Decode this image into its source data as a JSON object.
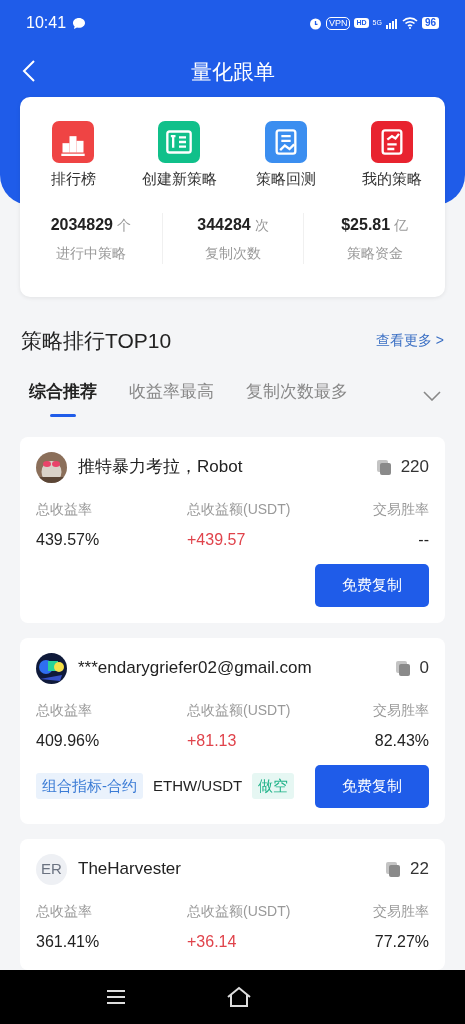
{
  "status_bar": {
    "time": "10:41",
    "vpn": "VPN",
    "hd": "HD",
    "network": "5G",
    "battery": "96"
  },
  "header": {
    "title": "量化跟单"
  },
  "shortcuts": [
    {
      "label": "排行榜",
      "color": "#ef4444"
    },
    {
      "label": "创建新策略",
      "color": "#10c08a"
    },
    {
      "label": "策略回测",
      "color": "#3b8ef0"
    },
    {
      "label": "我的策略",
      "color": "#e8232f"
    }
  ],
  "stats": [
    {
      "value": "2034829",
      "unit": "个",
      "label": "进行中策略"
    },
    {
      "value": "344284",
      "unit": "次",
      "label": "复制次数"
    },
    {
      "value": "$25.81",
      "unit": "亿",
      "label": "策略资金"
    }
  ],
  "section": {
    "title": "策略排行TOP10",
    "more": "查看更多 >"
  },
  "tabs": [
    {
      "label": "综合推荐",
      "selected": true
    },
    {
      "label": "收益率最高",
      "selected": false
    },
    {
      "label": "复制次数最多",
      "selected": false
    }
  ],
  "strategies": [
    {
      "avatar": {
        "kind": "picture"
      },
      "name": "推特暴力考拉，Robot",
      "copies": "220",
      "metrics": [
        {
          "label": "总收益率",
          "value": "439.57%",
          "kind": "plain"
        },
        {
          "label": "总收益额(USDT)",
          "value": "+439.57",
          "kind": "profit"
        },
        {
          "label": "交易胜率",
          "value": "--",
          "kind": "plain"
        }
      ],
      "button": "免费复制"
    },
    {
      "avatar": {
        "kind": "picture"
      },
      "name": "***endarygriefer02@gmail.com",
      "copies": "0",
      "metrics": [
        {
          "label": "总收益率",
          "value": "409.96%",
          "kind": "plain"
        },
        {
          "label": "总收益额(USDT)",
          "value": "+81.13",
          "kind": "profit"
        },
        {
          "label": "交易胜率",
          "value": "82.43%",
          "kind": "plain"
        }
      ],
      "tags": [
        {
          "text": "组合指标-合约",
          "kind": "category"
        },
        {
          "text": "ETHW/USDT",
          "kind": "pair"
        },
        {
          "text": "做空",
          "kind": "direction"
        }
      ],
      "button": "免费复制"
    },
    {
      "avatar": {
        "kind": "initials",
        "text": "ER"
      },
      "name": "TheHarvester",
      "copies": "22",
      "metrics": [
        {
          "label": "总收益率",
          "value": "361.41%",
          "kind": "plain"
        },
        {
          "label": "总收益额(USDT)",
          "value": "+36.14",
          "kind": "profit"
        },
        {
          "label": "交易胜率",
          "value": "77.27%",
          "kind": "plain"
        }
      ]
    }
  ]
}
